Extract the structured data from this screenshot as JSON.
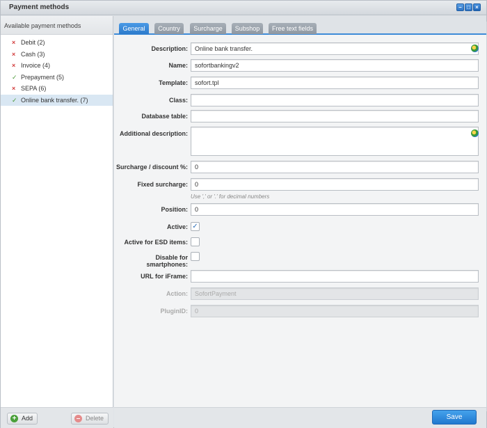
{
  "window": {
    "title": "Payment methods"
  },
  "left": {
    "header": "Available payment methods",
    "methods": [
      {
        "label": "Debit (2)",
        "active": false
      },
      {
        "label": "Cash (3)",
        "active": false
      },
      {
        "label": "Invoice (4)",
        "active": false
      },
      {
        "label": "Prepayment (5)",
        "active": true
      },
      {
        "label": "SEPA (6)",
        "active": false
      },
      {
        "label": "Online bank transfer. (7)",
        "active": true,
        "selected": true
      }
    ],
    "add_label": "Add",
    "delete_label": "Delete"
  },
  "tabs": [
    "General",
    "Country",
    "Surcharge",
    "Subshop",
    "Free text fields"
  ],
  "form": {
    "description": {
      "label": "Description:",
      "value": "Online bank transfer."
    },
    "name": {
      "label": "Name:",
      "value": "sofortbankingv2"
    },
    "template": {
      "label": "Template:",
      "value": "sofort.tpl"
    },
    "class": {
      "label": "Class:",
      "value": ""
    },
    "database_table": {
      "label": "Database table:",
      "value": ""
    },
    "additional_description": {
      "label": "Additional description:",
      "value": ""
    },
    "surcharge_discount": {
      "label": "Surcharge / discount %:",
      "value": "0"
    },
    "fixed_surcharge": {
      "label": "Fixed surcharge:",
      "value": "0",
      "hint": "Use ',' or '.' for decimal numbers"
    },
    "position": {
      "label": "Position:",
      "value": "0"
    },
    "active": {
      "label": "Active:",
      "checked": true
    },
    "active_esd": {
      "label": "Active for ESD items:",
      "checked": false
    },
    "disable_smartphones": {
      "label": "Disable for smartphones:",
      "checked": false
    },
    "url_iframe": {
      "label": "URL for iFrame:",
      "value": ""
    },
    "action": {
      "label": "Action:",
      "value": "SofortPayment"
    },
    "plugin_id": {
      "label": "PluginID:",
      "value": "0"
    }
  },
  "save_label": "Save",
  "colors": {
    "accent": "#3d8bd8",
    "error": "#d23c3c",
    "success": "#4c9a3a"
  }
}
